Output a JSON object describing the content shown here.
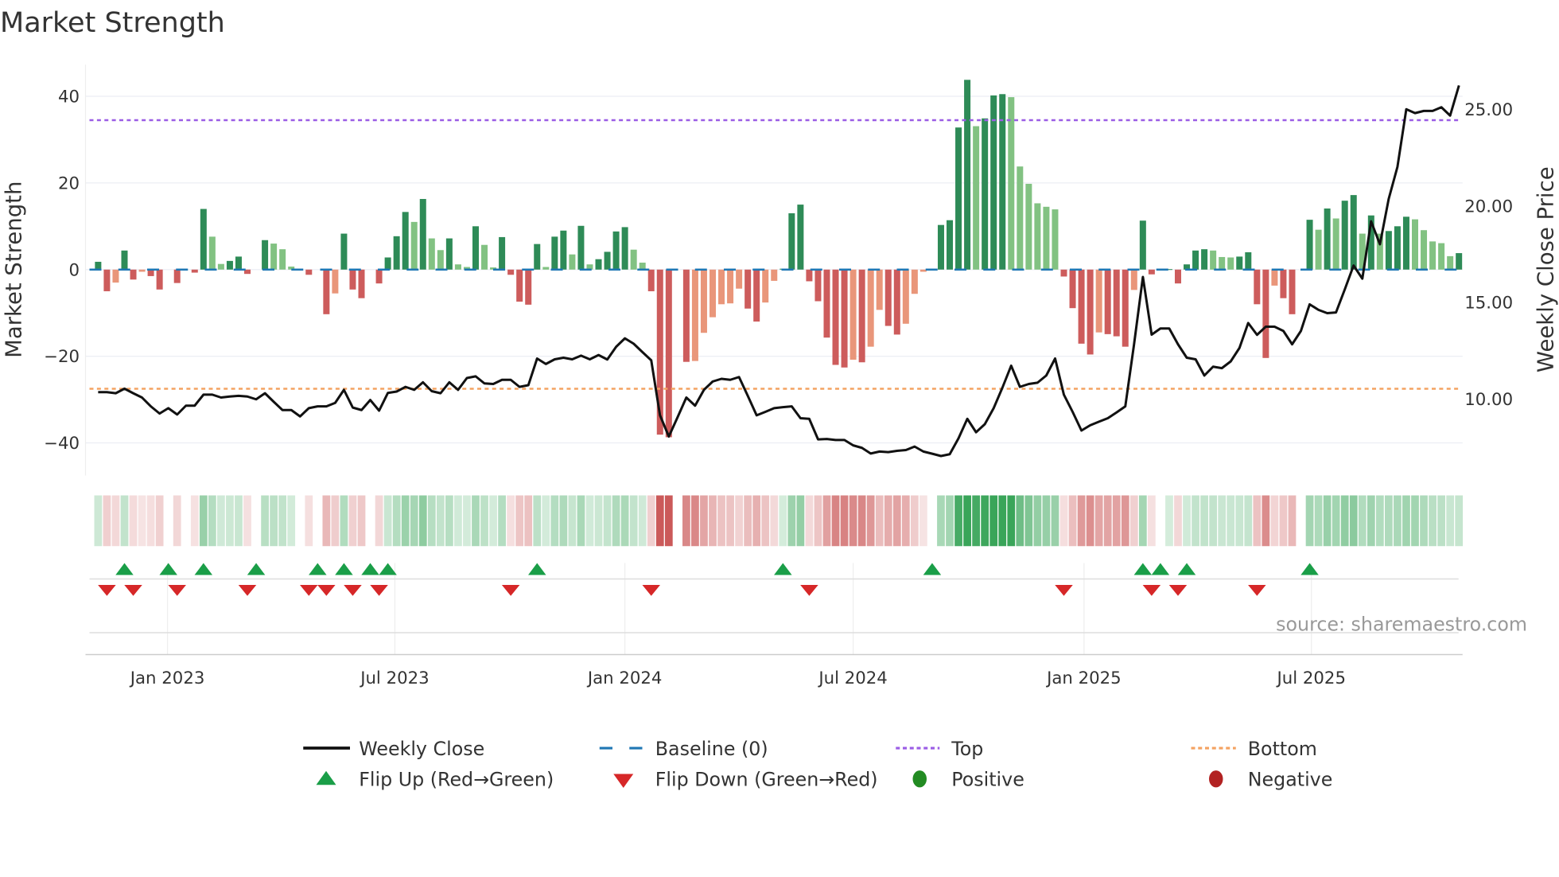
{
  "chart_data": {
    "type": "bar",
    "title": "Market Strength",
    "ylabel": "Market Strength",
    "y2label": "Weekly Close Price",
    "ylim": [
      -48,
      48
    ],
    "y2lim": [
      6.2,
      27
    ],
    "yticks": [
      "40",
      "20",
      "0",
      "−40",
      "−20"
    ],
    "ytick_values": [
      40,
      20,
      0,
      -40,
      -20
    ],
    "y2ticks": [
      "25.00",
      "20.00",
      "15.00",
      "10.00"
    ],
    "y2tick_values": [
      25,
      20,
      15,
      10
    ],
    "x_unit": "week index",
    "xticks": [
      {
        "label": "Jan 2023",
        "week": 7.9
      },
      {
        "label": "Jul 2023",
        "week": 33.8
      },
      {
        "label": "Jan 2024",
        "week": 60.0
      },
      {
        "label": "Jul 2024",
        "week": 86.0
      },
      {
        "label": "Jan 2025",
        "week": 112.3
      },
      {
        "label": "Jul 2025",
        "week": 138.2
      }
    ],
    "top_level": 34.5,
    "bottom_level": -27.5,
    "baseline": 0,
    "strength": [
      1.8,
      -5,
      -3,
      4.4,
      -2.3,
      -0.5,
      -1.5,
      -4.6,
      0,
      -3.1,
      0,
      -0.7,
      14,
      7.6,
      1.3,
      2,
      3,
      -1,
      0,
      6.8,
      6,
      4.7,
      0.7,
      0,
      -1.2,
      0,
      -10.3,
      -5.5,
      8.3,
      -4.6,
      -6.6,
      0,
      -3.2,
      2.8,
      7.7,
      13.3,
      11,
      16.3,
      7.2,
      4.5,
      7.2,
      1.2,
      0.6,
      10,
      5.7,
      0.5,
      7.5,
      -1.2,
      -7.4,
      -8.1,
      5.9,
      0.6,
      7.6,
      9,
      3.5,
      10.1,
      1.2,
      2.4,
      4.1,
      8.8,
      9.8,
      4.6,
      1.6,
      -5,
      -38.1,
      -38.7,
      0,
      -21.3,
      -21.1,
      -14.6,
      -11,
      -8,
      -7.8,
      -4.4,
      -9,
      -12,
      -7.6,
      -2.6,
      0.2,
      13,
      15,
      -2.7,
      -7.3,
      -15.7,
      -22,
      -22.6,
      -20.8,
      -21.4,
      -17.8,
      -9.3,
      -13,
      -15,
      -12.5,
      -5.6,
      -0.5,
      0,
      10.3,
      11.4,
      32.8,
      43.8,
      33.1,
      34.9,
      40.2,
      40.5,
      39.8,
      23.8,
      19.8,
      15.3,
      14.5,
      13.9,
      -1.6,
      -8.9,
      -17.1,
      -19.6,
      -14.5,
      -14.9,
      -15.4,
      -17.8,
      -4.7,
      11.3,
      -1.1,
      0,
      0.1,
      -3.2,
      1.2,
      4.4,
      4.7,
      4.4,
      2.9,
      2.8,
      3,
      4,
      -8,
      -20.4,
      -3.7,
      -6.6,
      -10.3,
      0,
      11.5,
      9.2,
      14.1,
      11.8,
      15.9,
      17.2,
      8.3,
      12.5,
      8.3,
      8.9,
      10,
      12.2,
      11.6,
      9.1,
      6.5,
      6.1,
      3.1,
      3.8
    ],
    "weekly_close": [
      10.3,
      10.3,
      10.24,
      10.48,
      10.24,
      10.02,
      9.56,
      9.19,
      9.47,
      9.14,
      9.6,
      9.6,
      10.17,
      10.17,
      10.02,
      10.07,
      10.11,
      10.07,
      9.93,
      10.24,
      9.8,
      9.37,
      9.37,
      9.04,
      9.47,
      9.56,
      9.56,
      9.74,
      10.42,
      9.5,
      9.37,
      9.89,
      9.34,
      10.26,
      10.33,
      10.57,
      10.42,
      10.81,
      10.35,
      10.24,
      10.81,
      10.42,
      11.03,
      11.12,
      10.75,
      10.72,
      10.94,
      10.94,
      10.57,
      10.66,
      12.04,
      11.76,
      12.0,
      12.08,
      12.0,
      12.19,
      12.0,
      12.22,
      11.99,
      12.65,
      13.09,
      12.81,
      12.37,
      11.95,
      9.1,
      8.0,
      9.0,
      10.02,
      9.6,
      10.42,
      10.85,
      10.99,
      10.94,
      11.08,
      10.11,
      9.1,
      9.28,
      9.47,
      9.52,
      9.56,
      8.95,
      8.92,
      7.85,
      7.87,
      7.82,
      7.82,
      7.54,
      7.41,
      7.12,
      7.22,
      7.19,
      7.26,
      7.3,
      7.48,
      7.22,
      7.11,
      6.99,
      7.08,
      7.9,
      8.92,
      8.22,
      8.64,
      9.47,
      10.53,
      11.67,
      10.57,
      10.72,
      10.79,
      11.16,
      12.04,
      10.17,
      9.28,
      8.31,
      8.58,
      8.77,
      8.95,
      9.25,
      9.56,
      12.78,
      16.27,
      13.28,
      13.6,
      13.6,
      12.78,
      12.08,
      12.0,
      11.16,
      11.62,
      11.54,
      11.89,
      12.59,
      13.88,
      13.27,
      13.69,
      13.69,
      13.47,
      12.78,
      13.47,
      14.85,
      14.56,
      14.39,
      14.43,
      15.63,
      16.86,
      16.18,
      19.15,
      17.96,
      20.31,
      21.97,
      24.96,
      24.76,
      24.87,
      24.87,
      25.06,
      24.63,
      26.19
    ],
    "flip_up_weeks": [
      3,
      8,
      12,
      18,
      25,
      28,
      31,
      33,
      50,
      78,
      95,
      119,
      121,
      124,
      138
    ],
    "flip_down_weeks": [
      1,
      4,
      9,
      17,
      24,
      26,
      29,
      32,
      47,
      63,
      81,
      110,
      120,
      123,
      132
    ],
    "legend": {
      "weekly_close": "Weekly Close",
      "baseline": "Baseline (0)",
      "top": "Top",
      "bottom": "Bottom",
      "flip_up": "Flip Up (Red→Green)",
      "flip_down": "Flip Down (Green→Red)",
      "positive": "Positive",
      "negative": "Negative"
    },
    "legend_placement": "bottom",
    "source": "source: sharemaestro.com",
    "colors": {
      "pos_strong": "#2e8b57",
      "pos_weak": "#82c282",
      "neg_strong": "#cd5c5c",
      "neg_weak": "#e9967a",
      "line": "#111111",
      "baseline": "#1f77b4",
      "top": "#9b5de5",
      "bottom": "#f4a261",
      "flip_up": "#1a9e48",
      "flip_down": "#d62728",
      "positive": "#228b22",
      "negative": "#b22222"
    }
  }
}
